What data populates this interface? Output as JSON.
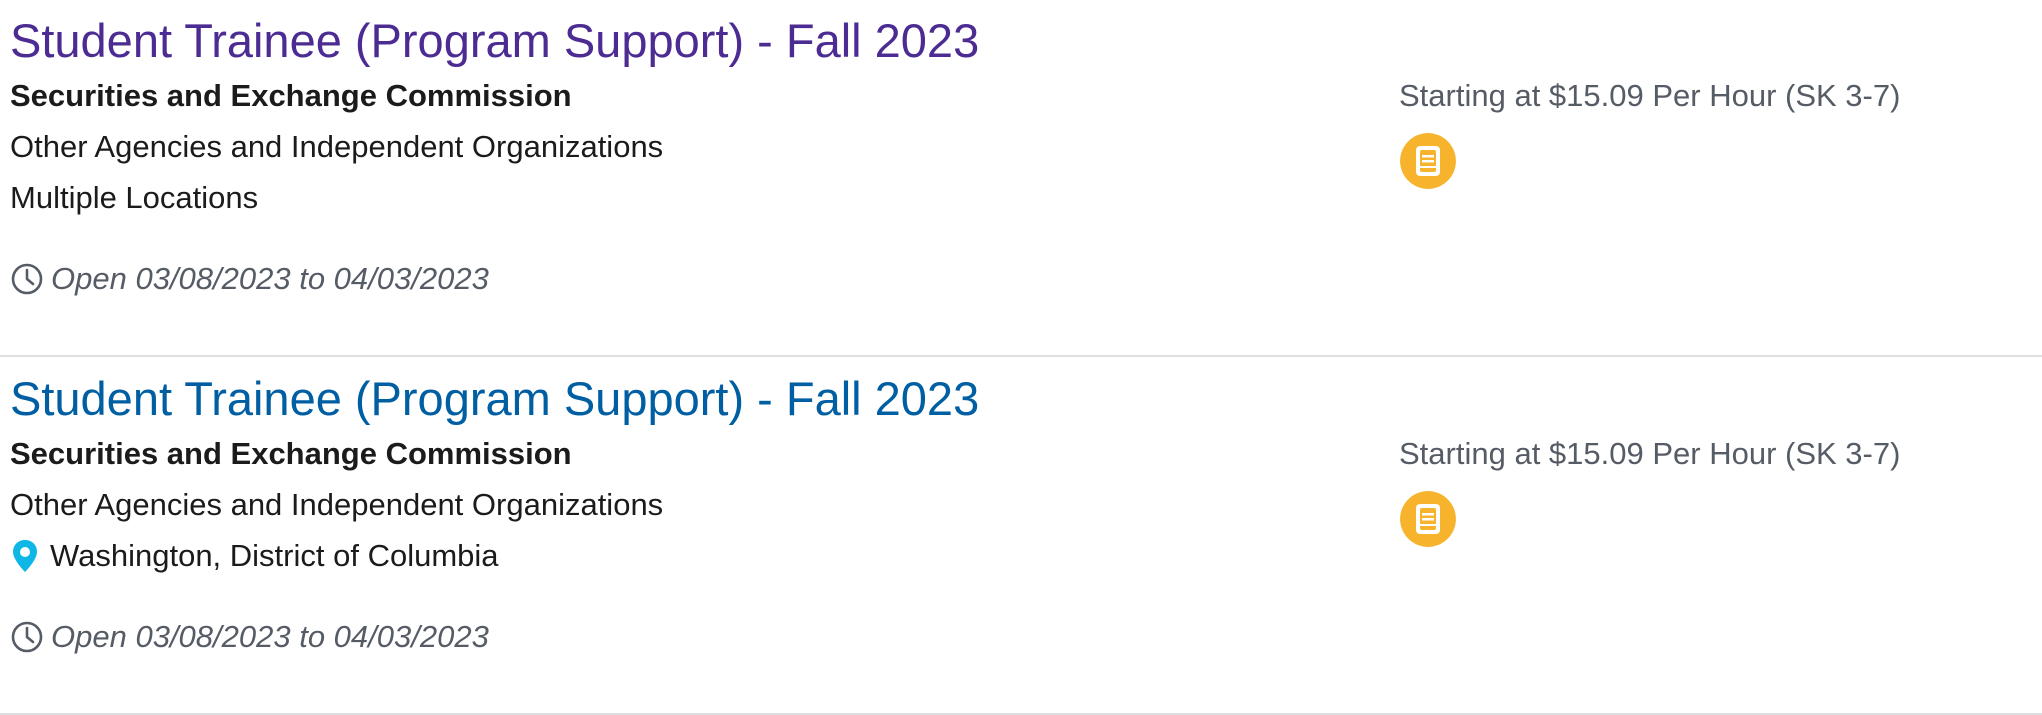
{
  "jobs": [
    {
      "title": "Student Trainee (Program Support) - Fall 2023",
      "visited": true,
      "agency": "Securities and Exchange Commission",
      "department": "Other Agencies and Independent Organizations",
      "location": "Multiple Locations",
      "location_icon": "",
      "dates": "Open 03/08/2023 to 04/03/2023",
      "salary": "Starting at $15.09 Per Hour (SK 3-7)",
      "badge_icon": "student-book-icon"
    },
    {
      "title": "Student Trainee (Program Support) - Fall 2023",
      "visited": false,
      "agency": "Securities and Exchange Commission",
      "department": "Other Agencies and Independent Organizations",
      "location": "Washington, District of Columbia",
      "location_icon": "location-pin-icon",
      "dates": "Open 03/08/2023 to 04/03/2023",
      "salary": "Starting at $15.09 Per Hour (SK 3-7)",
      "badge_icon": "student-book-icon"
    }
  ],
  "colors": {
    "visited_link": "#4c2c92",
    "link": "#005ea2",
    "badge": "#f7b32b",
    "pin": "#0fb7e6",
    "muted": "#565c65",
    "divider": "#dcdee0"
  }
}
